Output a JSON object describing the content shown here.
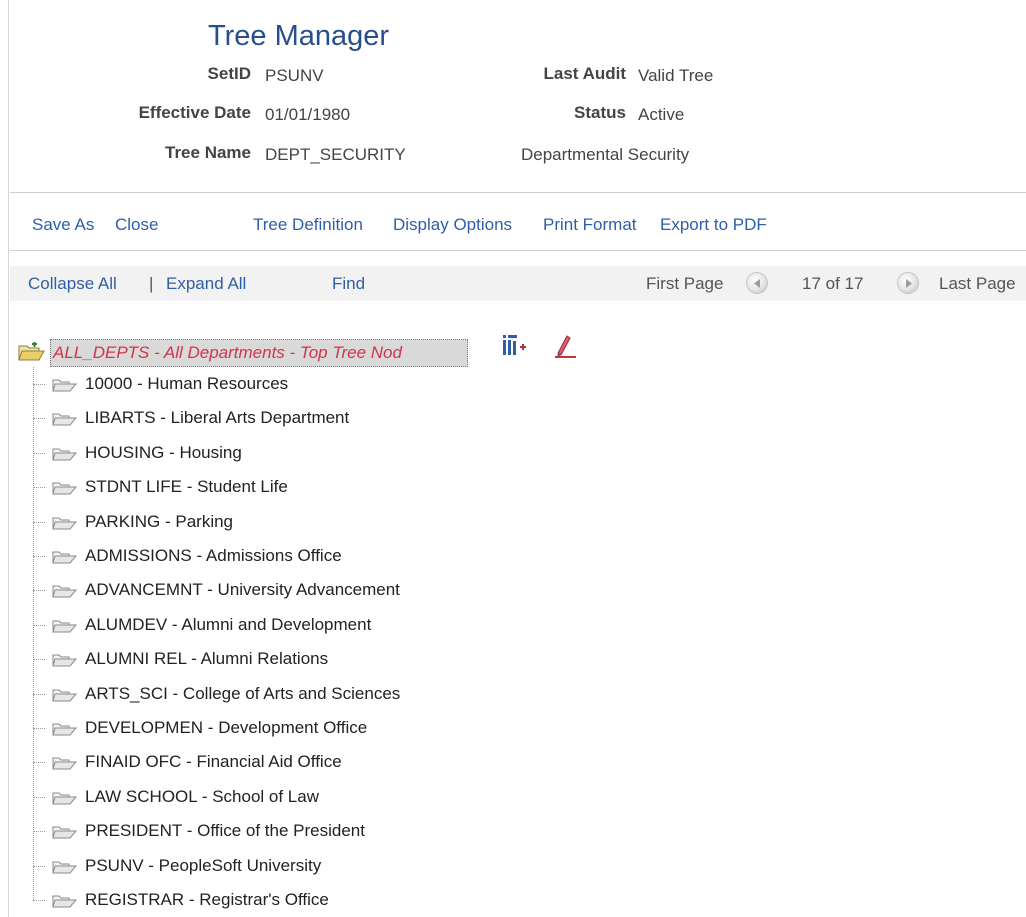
{
  "header": {
    "title": "Tree Manager",
    "setid_label": "SetID",
    "setid_value": "PSUNV",
    "last_audit_label": "Last Audit",
    "last_audit_value": "Valid Tree",
    "effective_date_label": "Effective Date",
    "effective_date_value": "01/01/1980",
    "status_label": "Status",
    "status_value": "Active",
    "tree_name_label": "Tree Name",
    "tree_name_value": "DEPT_SECURITY",
    "tree_description": "Departmental Security"
  },
  "toolbar": {
    "save_as": "Save As",
    "close": "Close",
    "tree_definition": "Tree Definition",
    "display_options": "Display Options",
    "print_format": "Print Format",
    "export_pdf": "Export to PDF"
  },
  "navbar": {
    "collapse_all": "Collapse All",
    "separator": "|",
    "expand_all": "Expand All",
    "find": "Find",
    "first_page": "First Page",
    "page_count": "17 of 17",
    "last_page": "Last Page",
    "prev_icon": "prev-arrow-icon",
    "next_icon": "next-arrow-icon"
  },
  "tree": {
    "root": {
      "label": "ALL_DEPTS - All Departments - Top Tree Nod",
      "icon": "open-folder-icon",
      "actions": [
        "insert-child-icon",
        "edit-icon"
      ]
    },
    "nodes": [
      "10000 - Human Resources",
      "LIBARTS - Liberal Arts Department",
      "HOUSING - Housing",
      "STDNT LIFE - Student Life",
      "PARKING - Parking",
      "ADMISSIONS - Admissions Office",
      "ADVANCEMNT - University Advancement",
      "ALUMDEV - Alumni and Development",
      "ALUMNI REL - Alumni Relations",
      "ARTS_SCI - College of Arts and Sciences",
      "DEVELOPMEN - Development Office",
      "FINAID OFC - Financial Aid Office",
      "LAW SCHOOL - School of Law",
      "PRESIDENT - Office of the President",
      "PSUNV - PeopleSoft University",
      "REGISTRAR - Registrar's Office"
    ]
  },
  "colors": {
    "title": "#284f8c",
    "link": "#2f5ea8",
    "root_text": "#d2344a",
    "root_highlight": "#d9d9d9"
  }
}
